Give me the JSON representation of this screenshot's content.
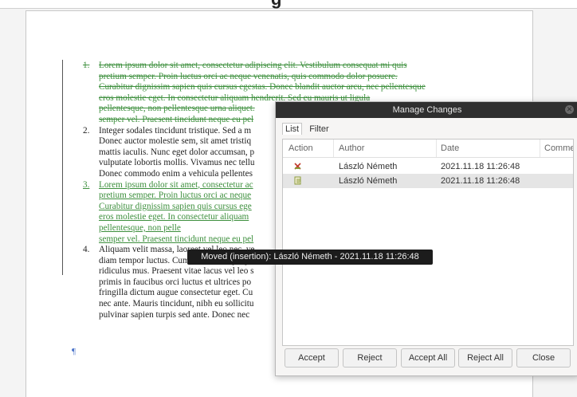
{
  "document": {
    "top_fragment": "g",
    "paragraphs": [
      {
        "number": "1.",
        "style": "del",
        "lines": [
          "Lorem ipsum dolor sit amet, consectetur adipiscing elit. Vestibulum consequat mi quis",
          "pretium semper. Proin luctus orci ac neque venenatis, quis commodo dolor posuere.",
          "Curabitur dignissim sapien quis cursus egestas. Donec blandit auctor arcu, nec pellentesque",
          "eros molestie eget. In consectetur aliquam hendrerit. Sed eu mauris ut ligula",
          "pellentesque, non pellentesque urna aliquet.",
          "semper vel. Praesent tincidunt neque eu pel"
        ]
      },
      {
        "number": "2.",
        "style": "normal",
        "lines": [
          "Integer sodales tincidunt tristique. Sed a m",
          "Donec auctor molestie sem, sit amet tristiq",
          "mattis iaculis. Nunc eget dolor accumsan, p",
          "vulputate lobortis mollis. Vivamus nec tellu",
          "Donec commodo enim a vehicula pellentes"
        ]
      },
      {
        "number": "3.",
        "style": "ins",
        "lines": [
          "Lorem ipsum dolor sit amet, consectetur ac",
          "pretium semper. Proin luctus orci ac neque",
          "Curabitur dignissim sapien quis cursus ege",
          "eros molestie eget. In consectetur aliquam",
          "pellentesque, non pelle",
          "semper vel. Praesent tincidunt neque eu pel"
        ]
      },
      {
        "number": "4.",
        "style": "normal",
        "lines": [
          "Aliquam velit massa, laoreet vel leo nec, ve",
          "diam tempor luctus. Cum sociis natoque pe",
          "ridiculus mus. Praesent vitae lacus vel leo s",
          "primis in faucibus orci luctus et ultrices po",
          "fringilla dictum augue consectetur eget. Cu",
          "nec ante. Mauris tincidunt, nibh eu sollicitu",
          "pulvinar sapien turpis sed ante. Donec nec"
        ]
      }
    ],
    "pilcrow": "¶"
  },
  "dialog": {
    "title": "Manage Changes",
    "close_glyph": "✕",
    "tabs": [
      "List",
      "Filter"
    ],
    "columns": [
      "Action",
      "Author",
      "Date",
      "Comment"
    ],
    "rows": [
      {
        "action_icon": "delete-change-icon",
        "author": "László Németh",
        "date": "2021.11.18 11:26:48"
      },
      {
        "action_icon": "move-insert-change-icon",
        "author": "László Németh",
        "date": "2021.11.18 11:26:48"
      }
    ],
    "buttons": [
      "Accept",
      "Reject",
      "Accept All",
      "Reject All",
      "Close"
    ]
  },
  "tooltip": {
    "text": "Moved (insertion): László Németh - 2021.11.18 11:26:48"
  },
  "colors": {
    "tracked_change": "#3d8f3d",
    "titlebar": "#2f2f2f",
    "tooltip_bg": "#1c1c1c",
    "selected_row": "#e5e5e5",
    "delete_icon": "#c0392b",
    "move_icon": "#8a9a3a"
  }
}
